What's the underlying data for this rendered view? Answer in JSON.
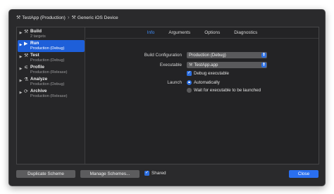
{
  "breadcrumb": {
    "project": "TestApp (Production)",
    "separator": "›",
    "device": "Generic iOS Device"
  },
  "sidebar": {
    "items": [
      {
        "label": "Build",
        "sub": "2 targets",
        "icon": "hammer-icon"
      },
      {
        "label": "Run",
        "sub": "Production (Debug)",
        "icon": "play-icon"
      },
      {
        "label": "Test",
        "sub": "Production (Debug)",
        "icon": "wrench-icon"
      },
      {
        "label": "Profile",
        "sub": "Production (Release)",
        "icon": "instruments-icon"
      },
      {
        "label": "Analyze",
        "sub": "Production (Debug)",
        "icon": "analyze-icon"
      },
      {
        "label": "Archive",
        "sub": "Production (Release)",
        "icon": "archive-icon"
      }
    ],
    "selected": "Run"
  },
  "tabs": [
    "Info",
    "Arguments",
    "Options",
    "Diagnostics"
  ],
  "active_tab": "Info",
  "form": {
    "build_configuration_label": "Build Configuration",
    "build_configuration_value": "Production (Debug)",
    "executable_label": "Executable",
    "executable_value": "TestApp.app",
    "debug_executable_label": "Debug executable",
    "debug_executable_checked": true,
    "launch_label": "Launch",
    "launch_options": [
      "Automatically",
      "Wait for executable to be launched"
    ],
    "launch_selected": "Automatically"
  },
  "footer": {
    "duplicate_label": "Duplicate Scheme",
    "manage_label": "Manage Schemes...",
    "shared_label": "Shared",
    "shared_checked": true,
    "close_label": "Close"
  },
  "colors": {
    "accent": "#2a6ff0",
    "active_tab": "#3f8cf6",
    "window_bg": "#2a2a2c"
  }
}
